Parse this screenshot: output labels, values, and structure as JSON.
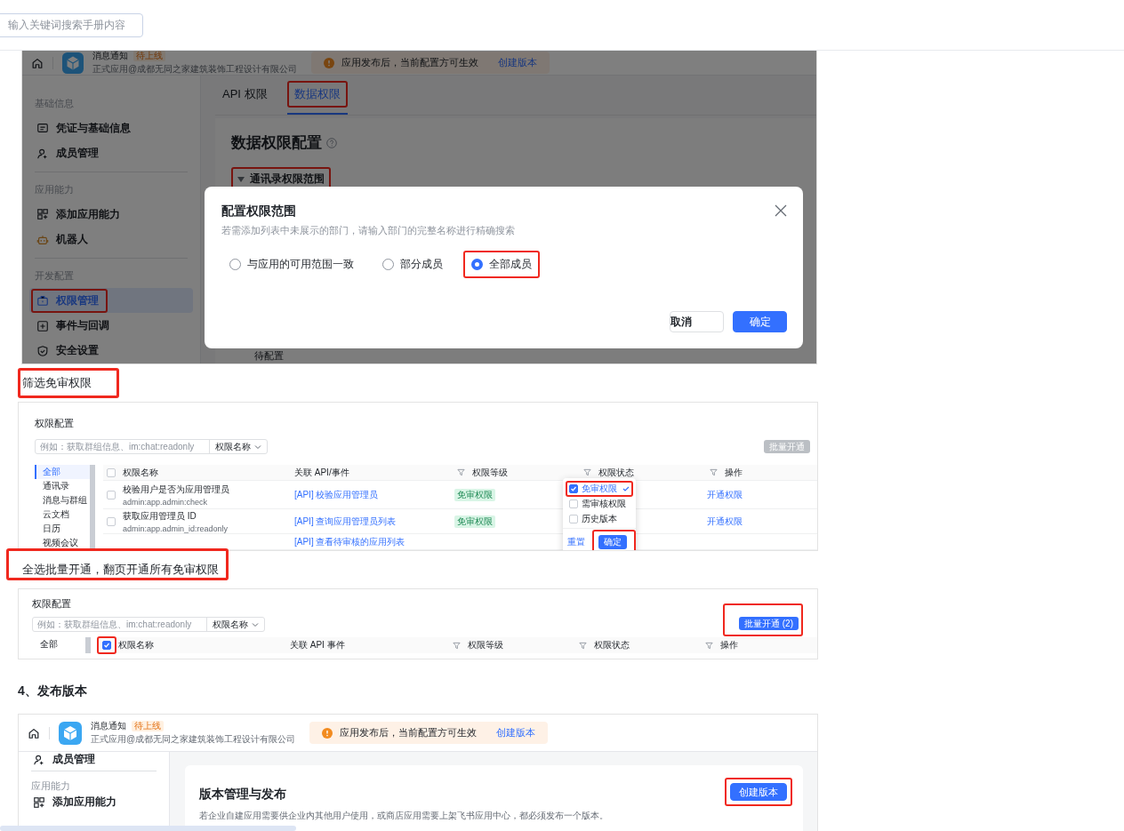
{
  "search": {
    "placeholder": "输入关键词搜索手册内容"
  },
  "permission_shot": {
    "header": {
      "app_name": "消息通知",
      "badge": "待上线",
      "org": "正式应用@成都无同之家建筑装饰工程设计有限公司",
      "notice": "应用发布后，当前配置方可生效",
      "notice_link": "创建版本"
    },
    "sidebar": [
      {
        "title": "基础信息",
        "items": [
          {
            "label": "凭证与基础信息",
            "selected": false,
            "highlighted": false
          },
          {
            "label": "成员管理",
            "selected": false,
            "highlighted": false
          }
        ]
      },
      {
        "title": "应用能力",
        "items": [
          {
            "label": "添加应用能力",
            "selected": false,
            "highlighted": false
          },
          {
            "label": "机器人",
            "selected": false,
            "highlighted": false
          }
        ]
      },
      {
        "title": "开发配置",
        "items": [
          {
            "label": "权限管理",
            "selected": true,
            "highlighted": true
          },
          {
            "label": "事件与回调",
            "selected": false,
            "highlighted": false
          },
          {
            "label": "安全设置",
            "selected": false,
            "highlighted": false
          }
        ]
      }
    ],
    "tabs": [
      {
        "label": "API 权限",
        "selected": false,
        "highlighted": false
      },
      {
        "label": "数据权限",
        "selected": true,
        "highlighted": true
      }
    ],
    "panel_title": "数据权限配置",
    "section": {
      "label": "通讯录权限范围",
      "expanded": true,
      "highlighted": true
    },
    "status": "待配置",
    "dialog": {
      "title": "配置权限范围",
      "hint": "若需添加列表中未展示的部门，请输入部门的完整名称进行精确搜索",
      "options": [
        {
          "label": "与应用的可用范围一致",
          "selected": false,
          "highlighted": false
        },
        {
          "label": "部分成员",
          "selected": false,
          "highlighted": false
        },
        {
          "label": "全部成员",
          "selected": true,
          "highlighted": true
        }
      ],
      "buttons": [
        {
          "label": "取消",
          "kind": "secondary"
        },
        {
          "label": "确定",
          "kind": "primary"
        }
      ]
    }
  },
  "caption_filter": {
    "text": "筛选免审权限",
    "highlighted": true
  },
  "filter_shot": {
    "title": "权限配置",
    "search_placeholder": "例如：获取群组信息、im:chat:readonly",
    "search_scope": "权限名称",
    "batch_button": {
      "label": "批量开通",
      "disabled": true
    },
    "categories": [
      {
        "label": "全部",
        "selected": true
      },
      {
        "label": "通讯录",
        "selected": false
      },
      {
        "label": "消息与群组",
        "selected": false
      },
      {
        "label": "云文档",
        "selected": false
      },
      {
        "label": "日历",
        "selected": false
      },
      {
        "label": "视频会议",
        "selected": false
      }
    ],
    "select_all": {
      "checked": false
    },
    "columns": [
      "权限名称",
      "关联 API/事件",
      "权限等级",
      "权限状态",
      "操作"
    ],
    "rows": [
      {
        "checked": false,
        "name": "校验用户是否为应用管理员",
        "scope": "admin:app.admin:check",
        "api": "[API] 校验应用管理员",
        "level": "免审权限",
        "action": "开通权限"
      },
      {
        "checked": false,
        "name": "获取应用管理员 ID",
        "scope": "admin:app.admin_id:readonly",
        "api": "[API] 查询应用管理员列表",
        "level": "免审权限",
        "action": "开通权限"
      },
      {
        "api": "[API] 查看待审核的应用列表"
      }
    ],
    "filter_menu": {
      "options": [
        {
          "label": "免审权限",
          "checked": true,
          "highlighted": true
        },
        {
          "label": "需审核权限",
          "checked": false,
          "highlighted": false
        },
        {
          "label": "历史版本",
          "checked": false,
          "highlighted": false
        }
      ],
      "reset": "重置",
      "confirm": {
        "label": "确定",
        "highlighted": true
      }
    }
  },
  "caption_batch": {
    "text": "全选批量开通，翻页开通所有免审权限",
    "highlighted": true
  },
  "batch_shot": {
    "title": "权限配置",
    "search_placeholder": "例如：获取群组信息、im:chat:readonly",
    "search_scope": "权限名称",
    "batch_button": {
      "label": "批量开通 (2)",
      "disabled": false,
      "highlighted": true
    },
    "categories": [
      {
        "label": "全部",
        "selected": false
      }
    ],
    "select_all": {
      "checked": true,
      "highlighted": true
    },
    "columns": [
      "权限名称",
      "关联 API 事件",
      "权限等级",
      "权限状态",
      "操作"
    ]
  },
  "heading": "4、发布版本",
  "release_shot": {
    "header": {
      "app_name": "消息通知",
      "badge": "待上线",
      "org": "正式应用@成都无同之家建筑装饰工程设计有限公司",
      "notice": "应用发布后，当前配置方可生效",
      "notice_link": "创建版本"
    },
    "sidebar": [
      {
        "items": [
          {
            "label": "成员管理",
            "selected": false,
            "highlighted": false
          }
        ]
      },
      {
        "title": "应用能力",
        "items": [
          {
            "label": "添加应用能力",
            "selected": false,
            "highlighted": false
          }
        ]
      }
    ],
    "card": {
      "title": "版本管理与发布",
      "description": "若企业自建应用需要供企业内其他用户使用，或商店应用需要上架飞书应用中心，都必须发布一个版本。",
      "button": {
        "label": "创建版本",
        "highlighted": true
      }
    }
  }
}
